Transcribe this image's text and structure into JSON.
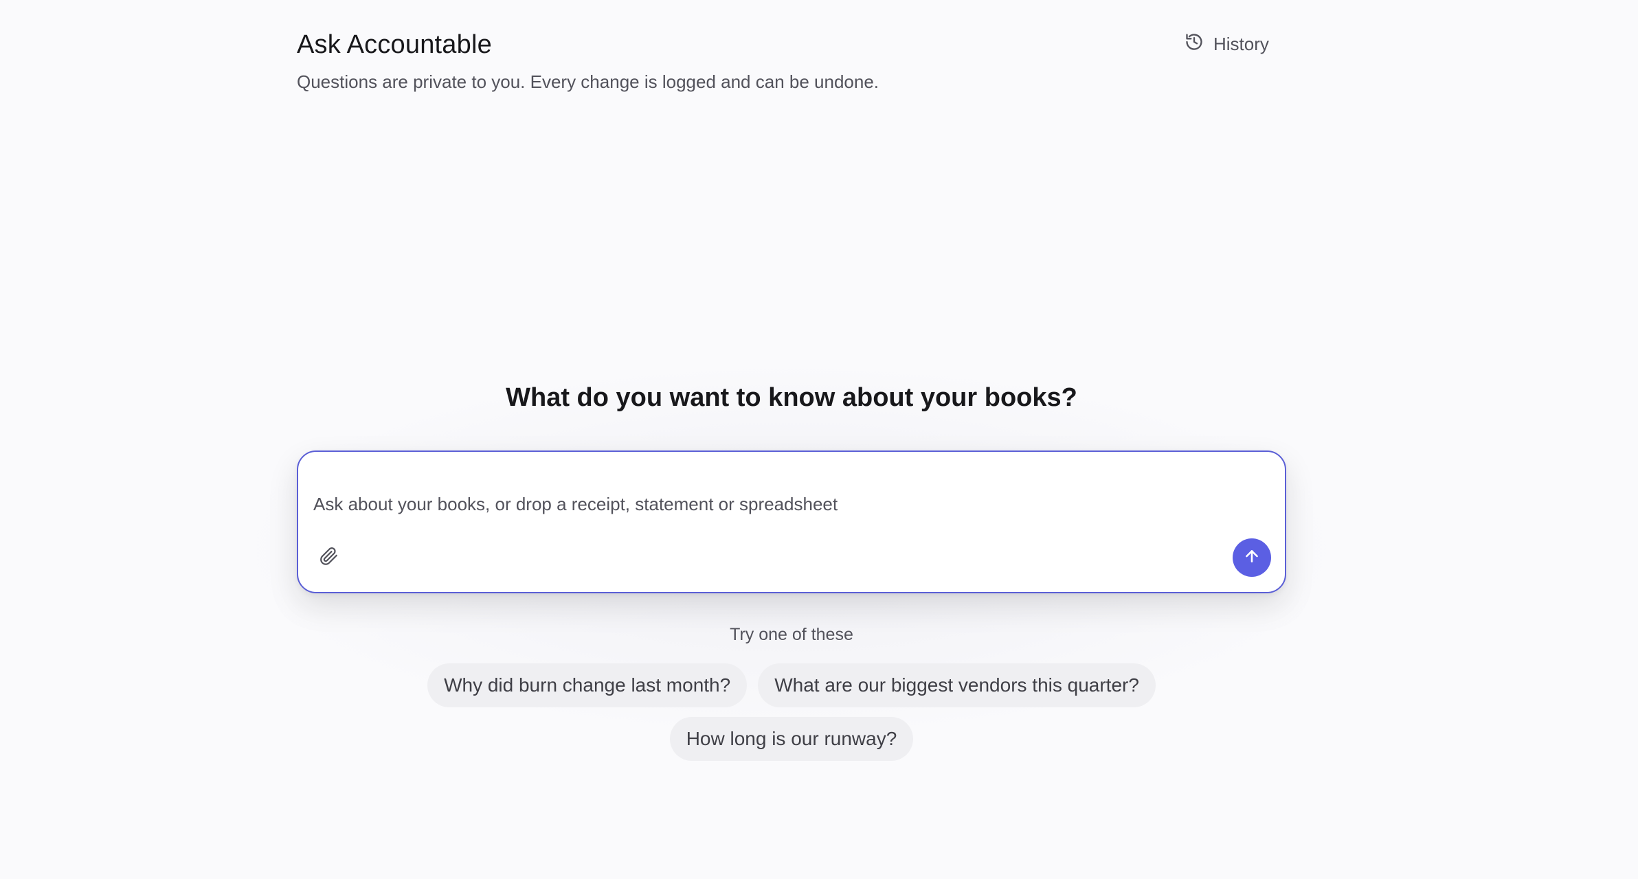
{
  "header": {
    "title": "Ask Accountable",
    "subtitle": "Questions are private to you. Every change is logged and can be undone.",
    "history_label": "History"
  },
  "main": {
    "heading": "What do you want to know about your books?",
    "composer": {
      "placeholder": "Ask about your books, or drop a receipt, statement or spreadsheet",
      "value": "",
      "attach_icon": "paperclip-icon",
      "send_icon": "arrow-up-icon"
    },
    "suggestions": {
      "label": "Try one of these",
      "items": [
        "Why did burn change last month?",
        "What are our biggest vendors this quarter?",
        "How long is our runway?"
      ]
    }
  },
  "colors": {
    "accent": "#5b5fe3",
    "composer_border": "#5b5fd6",
    "background": "#fafafc",
    "chip_background": "#efeff2",
    "text_primary": "#18181b",
    "text_secondary": "#52525b"
  }
}
